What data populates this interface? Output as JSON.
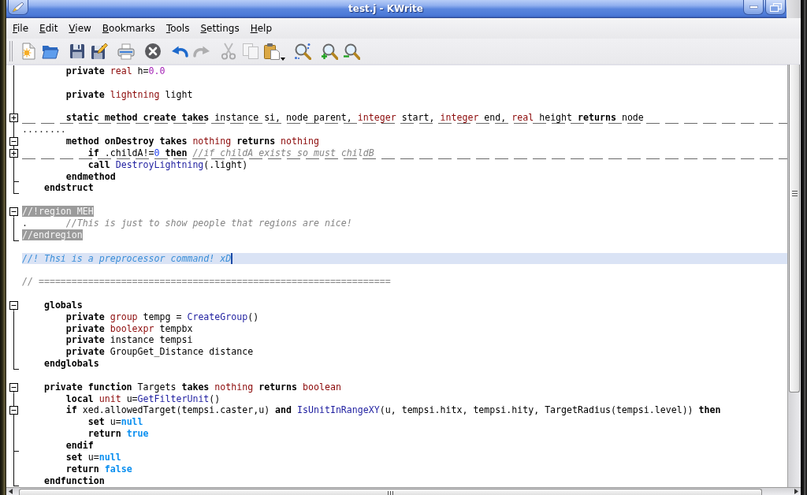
{
  "window": {
    "title": "test.j - KWrite"
  },
  "menu": [
    "File",
    "Edit",
    "View",
    "Bookmarks",
    "Tools",
    "Settings",
    "Help"
  ],
  "toolbar": {
    "groups": [
      [
        {
          "kind": "new",
          "disabled": false
        },
        {
          "kind": "open",
          "disabled": false
        }
      ],
      [
        {
          "kind": "save",
          "disabled": false
        },
        {
          "kind": "save_as",
          "disabled": false
        }
      ],
      [
        {
          "kind": "print",
          "disabled": false
        }
      ],
      [
        {
          "kind": "close",
          "disabled": false
        }
      ],
      [
        {
          "kind": "undo",
          "disabled": false
        },
        {
          "kind": "redo",
          "disabled": true
        }
      ],
      [
        {
          "kind": "cut",
          "disabled": true
        },
        {
          "kind": "copy",
          "disabled": true
        },
        {
          "kind": "paste",
          "disabled": false
        }
      ],
      [
        {
          "kind": "find",
          "disabled": false
        }
      ],
      [
        {
          "kind": "zoom_in",
          "disabled": false
        },
        {
          "kind": "zoom_out",
          "disabled": false
        }
      ]
    ]
  },
  "editor": {
    "lines": [
      {
        "kind": "fold_body",
        "current": false,
        "tokens": [
          {
            "text": "        private ",
            "kind": "keyword"
          },
          {
            "text": "real",
            "kind": "type"
          },
          {
            "text": " h=",
            "kind": "plain"
          },
          {
            "text": "0.0",
            "kind": "float"
          }
        ]
      },
      {
        "kind": "fold_body",
        "current": false
      },
      {
        "kind": "fold_body",
        "current": false,
        "tokens": [
          {
            "text": "        private ",
            "kind": "keyword"
          },
          {
            "text": "lightning",
            "kind": "type"
          },
          {
            "text": " light",
            "kind": "plain"
          }
        ]
      },
      {
        "kind": "fold_body",
        "current": false
      },
      {
        "kind": "fold_closed",
        "current": false,
        "tokens": [
          {
            "text": "        static method create takes ",
            "kind": "keyword"
          },
          {
            "text": "instance si, node parent, ",
            "kind": "plain"
          },
          {
            "text": "integer",
            "kind": "type"
          },
          {
            "text": " start, ",
            "kind": "plain"
          },
          {
            "text": "integer",
            "kind": "type"
          },
          {
            "text": " end, ",
            "kind": "plain"
          },
          {
            "text": "real",
            "kind": "type"
          },
          {
            "text": " height ",
            "kind": "plain"
          },
          {
            "text": "returns",
            "kind": "keyword"
          },
          {
            "text": " node",
            "kind": "plain"
          }
        ]
      },
      {
        "kind": "fold_body",
        "current": false,
        "tokens": [
          {
            "text": "........",
            "kind": "marker"
          }
        ]
      },
      {
        "kind": "fold_open",
        "current": false,
        "tokens": [
          {
            "text": "        method onDestroy takes ",
            "kind": "keyword"
          },
          {
            "text": "nothing",
            "kind": "type"
          },
          {
            "text": " returns ",
            "kind": "keyword"
          },
          {
            "text": "nothing",
            "kind": "type"
          }
        ]
      },
      {
        "kind": "fold_closed",
        "current": false,
        "tokens": [
          {
            "text": "            if ",
            "kind": "keyword"
          },
          {
            "text": ".childA!=",
            "kind": "plain"
          },
          {
            "text": "0",
            "kind": "integer"
          },
          {
            "text": " then ",
            "kind": "keyword"
          },
          {
            "text": "//if childA exists so must childB",
            "kind": "comment"
          }
        ]
      },
      {
        "kind": "fold_body",
        "current": false,
        "tokens": [
          {
            "text": "            call ",
            "kind": "keyword"
          },
          {
            "text": "DestroyLightning",
            "kind": "function"
          },
          {
            "text": "(.light)",
            "kind": "plain"
          }
        ]
      },
      {
        "kind": "fold_end",
        "current": false,
        "tokens": [
          {
            "text": "        endmethod",
            "kind": "keyword"
          }
        ]
      },
      {
        "kind": "fold_end",
        "current": false,
        "tokens": [
          {
            "text": "    endstruct",
            "kind": "keyword"
          }
        ]
      },
      {
        "kind": "plain",
        "current": false
      },
      {
        "kind": "fold_open",
        "current": false,
        "tokens": [
          {
            "text": "//!region MEH",
            "kind": "region"
          }
        ]
      },
      {
        "kind": "fold_body",
        "current": false,
        "tokens": [
          {
            "text": ".",
            "kind": "marker"
          },
          {
            "text": "       //This is just to show people that regions are nice!",
            "kind": "comment"
          }
        ]
      },
      {
        "kind": "fold_end",
        "current": false,
        "tokens": [
          {
            "text": "//endregion",
            "kind": "region"
          }
        ]
      },
      {
        "kind": "plain",
        "current": false
      },
      {
        "kind": "plain",
        "current": true,
        "tokens": [
          {
            "text": "//! Thsi is a preprocessor command! xD",
            "kind": "preprocessor"
          }
        ]
      },
      {
        "kind": "plain",
        "current": false
      },
      {
        "kind": "plain",
        "current": false,
        "tokens": [
          {
            "text": "// ================================================================",
            "kind": "comment"
          }
        ]
      },
      {
        "kind": "plain",
        "current": false
      },
      {
        "kind": "fold_open",
        "current": false,
        "tokens": [
          {
            "text": "    globals",
            "kind": "keyword"
          }
        ]
      },
      {
        "kind": "fold_body",
        "current": false,
        "tokens": [
          {
            "text": "        private ",
            "kind": "keyword"
          },
          {
            "text": "group",
            "kind": "type"
          },
          {
            "text": " tempg = ",
            "kind": "plain"
          },
          {
            "text": "CreateGroup",
            "kind": "function"
          },
          {
            "text": "()",
            "kind": "plain"
          }
        ]
      },
      {
        "kind": "fold_body",
        "current": false,
        "tokens": [
          {
            "text": "        private ",
            "kind": "keyword"
          },
          {
            "text": "boolexpr",
            "kind": "type"
          },
          {
            "text": " tempbx",
            "kind": "plain"
          }
        ]
      },
      {
        "kind": "fold_body",
        "current": false,
        "tokens": [
          {
            "text": "        private ",
            "kind": "keyword"
          },
          {
            "text": "instance tempsi",
            "kind": "plain"
          }
        ]
      },
      {
        "kind": "fold_body",
        "current": false,
        "tokens": [
          {
            "text": "        private ",
            "kind": "keyword"
          },
          {
            "text": "GroupGet_Distance distance",
            "kind": "plain"
          }
        ]
      },
      {
        "kind": "fold_end",
        "current": false,
        "tokens": [
          {
            "text": "    endglobals",
            "kind": "keyword"
          }
        ]
      },
      {
        "kind": "plain",
        "current": false
      },
      {
        "kind": "fold_open",
        "current": false,
        "tokens": [
          {
            "text": "    private function ",
            "kind": "keyword"
          },
          {
            "text": "Targets ",
            "kind": "plain"
          },
          {
            "text": "takes ",
            "kind": "keyword"
          },
          {
            "text": "nothing",
            "kind": "type"
          },
          {
            "text": " returns ",
            "kind": "keyword"
          },
          {
            "text": "boolean",
            "kind": "type"
          }
        ]
      },
      {
        "kind": "fold_body",
        "current": false,
        "tokens": [
          {
            "text": "        local ",
            "kind": "keyword"
          },
          {
            "text": "unit",
            "kind": "type"
          },
          {
            "text": " u=",
            "kind": "plain"
          },
          {
            "text": "GetFilterUnit",
            "kind": "function"
          },
          {
            "text": "()",
            "kind": "plain"
          }
        ]
      },
      {
        "kind": "fold_open",
        "current": false,
        "tokens": [
          {
            "text": "        if ",
            "kind": "keyword"
          },
          {
            "text": "xed.allowedTarget(tempsi.caster,u) ",
            "kind": "plain"
          },
          {
            "text": "and ",
            "kind": "keyword"
          },
          {
            "text": "IsUnitInRangeXY",
            "kind": "function"
          },
          {
            "text": "(u, tempsi.hitx, tempsi.hity, TargetRadius(tempsi.level)) ",
            "kind": "plain"
          },
          {
            "text": "then",
            "kind": "keyword"
          }
        ]
      },
      {
        "kind": "fold_body",
        "current": false,
        "tokens": [
          {
            "text": "            set ",
            "kind": "keyword"
          },
          {
            "text": "u=",
            "kind": "plain"
          },
          {
            "text": "null",
            "kind": "constant"
          }
        ]
      },
      {
        "kind": "fold_body",
        "current": false,
        "tokens": [
          {
            "text": "            return ",
            "kind": "keyword"
          },
          {
            "text": "true",
            "kind": "constant"
          }
        ]
      },
      {
        "kind": "fold_end",
        "current": false,
        "tokens": [
          {
            "text": "        endif",
            "kind": "keyword"
          }
        ]
      },
      {
        "kind": "fold_body",
        "current": false,
        "tokens": [
          {
            "text": "        set ",
            "kind": "keyword"
          },
          {
            "text": "u=",
            "kind": "plain"
          },
          {
            "text": "null",
            "kind": "constant"
          }
        ]
      },
      {
        "kind": "fold_body",
        "current": false,
        "tokens": [
          {
            "text": "        return ",
            "kind": "keyword"
          },
          {
            "text": "false",
            "kind": "constant"
          }
        ]
      },
      {
        "kind": "fold_end",
        "current": false,
        "tokens": [
          {
            "text": "    endfunction",
            "kind": "keyword"
          }
        ]
      }
    ]
  }
}
